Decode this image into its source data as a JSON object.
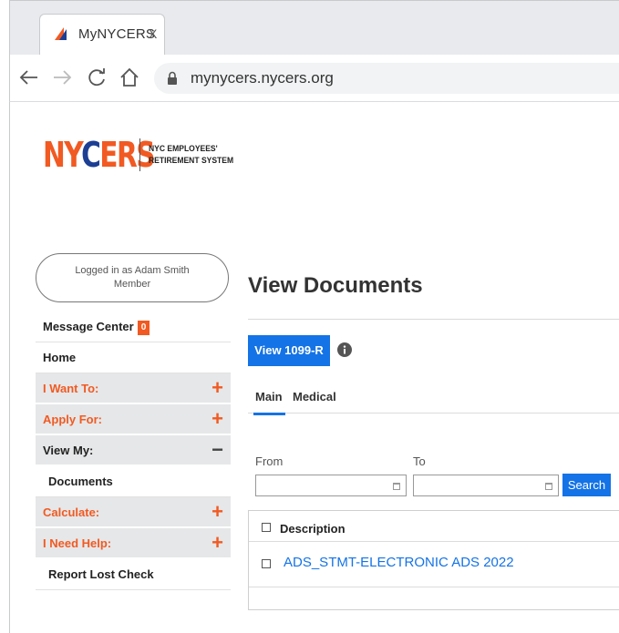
{
  "browser": {
    "tab_title": "MyNYCERS",
    "tab_close": "X",
    "url": "mynycers.nycers.org"
  },
  "logo": {
    "wordmark_part1": "NY",
    "wordmark_part2": "C",
    "wordmark_part3": "ERS",
    "tagline_line1": "NYC EMPLOYEES'",
    "tagline_line2": "RETIREMENT SYSTEM"
  },
  "user": {
    "logged_in_text": "Logged in as Adam Smith",
    "role": "Member"
  },
  "sidebar": {
    "message_center_label": "Message Center",
    "message_count": "0",
    "home_label": "Home",
    "i_want_to_label": "I Want To:",
    "apply_for_label": "Apply For:",
    "view_my_label": "View My:",
    "documents_label": "Documents",
    "calculate_label": "Calculate:",
    "i_need_help_label": "I Need Help:",
    "report_lost_check_label": "Report Lost Check",
    "plus_glyph": "+",
    "minus_glyph": "−"
  },
  "main": {
    "page_title": "View Documents",
    "view_1099_label": "View 1099-R",
    "tabs": [
      "Main",
      "Medical"
    ],
    "from_label": "From",
    "to_label": "To",
    "search_label": "Search",
    "table_header": "Description",
    "documents": [
      "ADS_STMT-ELECTRONIC ADS 2022"
    ]
  },
  "colors": {
    "brand_orange": "#f15a22",
    "brand_blue": "#1c3f94",
    "action_blue": "#1473e6"
  }
}
